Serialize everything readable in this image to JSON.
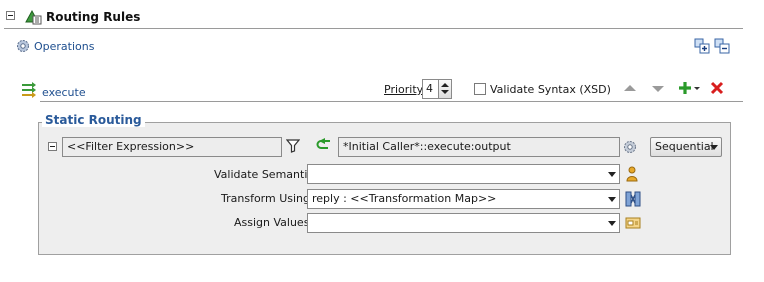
{
  "header": {
    "title": "Routing Rules"
  },
  "operations": {
    "label": "Operations"
  },
  "route": {
    "name": "execute",
    "priority_label": "Priority",
    "priority_value": "4",
    "validate_syntax_label": "Validate Syntax (XSD)",
    "validate_syntax_checked": false
  },
  "static_routing": {
    "title": "Static Routing",
    "filter_expression": "<<Filter Expression>>",
    "target": "*Initial Caller*::execute:output",
    "execution": "Sequential",
    "validate_semantic_label": "Validate Semantic",
    "validate_semantic_value": "",
    "transform_using_label": "Transform Using",
    "transform_using_value": "reply : <<Transformation Map>>",
    "assign_values_label": "Assign Values",
    "assign_values_value": ""
  },
  "icons": {
    "collapse": "minus-box-icon",
    "routing_rules": "routing-rules-icon",
    "operations": "gear-icon",
    "expand_all": "expand-all-icon",
    "collapse_all": "collapse-all-icon",
    "route": "route-icon",
    "move_up": "arrow-up-icon",
    "move_down": "arrow-down-icon",
    "add": "plus-icon",
    "delete": "red-x-icon",
    "filter": "funnel-icon",
    "target_refresh": "green-return-arrow-icon",
    "target_gear": "gear-icon",
    "semantic": "person-icon",
    "transform": "transformation-map-icon",
    "assign": "assign-values-icon"
  },
  "colors": {
    "section_title": "#2a5a9a",
    "add_green": "#2a9a2a",
    "delete_red": "#d81e1e",
    "panel_bg": "#eeeeee"
  }
}
